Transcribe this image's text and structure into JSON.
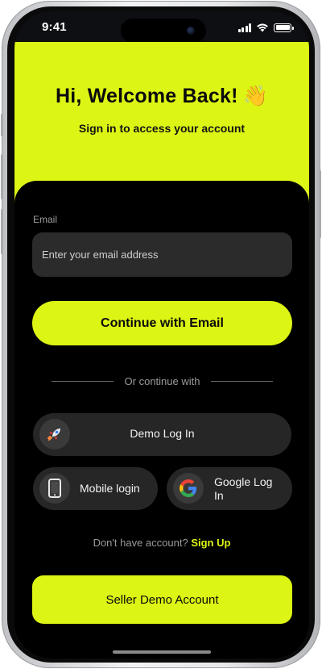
{
  "status_bar": {
    "time": "9:41"
  },
  "header": {
    "title": "Hi, Welcome Back!",
    "emoji": "👋",
    "subtitle": "Sign in to access your account"
  },
  "form": {
    "email_label": "Email",
    "email_placeholder": "Enter your email address",
    "email_value": "",
    "continue_label": "Continue with Email"
  },
  "divider_text": "Or continue with",
  "social": {
    "demo": {
      "label": "Demo Log In",
      "icon": "rocket-icon"
    },
    "mobile": {
      "label": "Mobile login",
      "icon": "smartphone-icon"
    },
    "google": {
      "label": "Google Log In",
      "icon": "google-icon"
    }
  },
  "signup": {
    "prompt": "Don't have account?",
    "link": "Sign Up"
  },
  "seller_button": "Seller Demo Account",
  "colors": {
    "accent": "#dcf514",
    "background": "#000000",
    "input_bg": "#2b2b2b",
    "pill_bg": "#262626"
  }
}
